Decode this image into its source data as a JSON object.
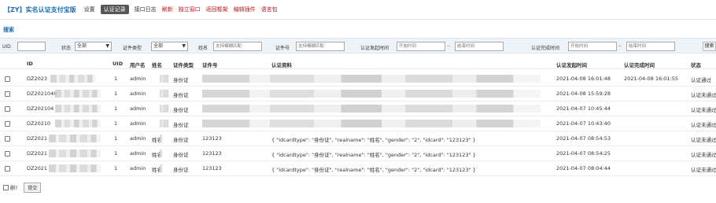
{
  "header": {
    "title": "【ZY】实名认证支付宝版",
    "nav": [
      {
        "label": "设置",
        "style": "normal"
      },
      {
        "label": "认证记录",
        "style": "active"
      },
      {
        "label": "接口日志",
        "style": "normal"
      },
      {
        "label": "刷新",
        "style": "red"
      },
      {
        "label": "独立窗口",
        "style": "red"
      },
      {
        "label": "返回框架",
        "style": "red"
      },
      {
        "label": "编辑插件",
        "style": "red"
      },
      {
        "label": "语言包",
        "style": "red"
      }
    ]
  },
  "search": {
    "title": "搜索",
    "uid_label": "UID",
    "status_label": "状态",
    "status_value": "全部",
    "cert_type_label": "证件类型",
    "cert_type_value": "全部",
    "name_label": "姓名",
    "name_placeholder": "支持模糊匹配",
    "cert_no_label": "证件号",
    "cert_no_placeholder": "支持模糊匹配",
    "start_label": "认证发起时间",
    "start_from_placeholder": "开始时间",
    "start_to_placeholder": "结束时间",
    "end_label": "认证完成时间",
    "end_from_placeholder": "开始时间",
    "end_to_placeholder": "结束时间",
    "dash": "--",
    "button": "搜索"
  },
  "table": {
    "headers": {
      "id": "ID",
      "uid": "UID",
      "username": "用户名",
      "name": "姓名",
      "cert_type": "证件类型",
      "cert_no": "证件号",
      "data": "认证资料",
      "start_time": "认证发起时间",
      "end_time": "认证完成时间",
      "status": "状态"
    },
    "rows": [
      {
        "id": "DZ2023",
        "uid": "1",
        "username": "admin",
        "name": "",
        "cert_type": "身份证",
        "cert_no": "",
        "data": "",
        "start_time": "2021-04-08 16:01:48",
        "end_time": "2021-04-08 16:01:55",
        "status": "认证通过"
      },
      {
        "id": "DZ2021040",
        "uid": "1",
        "username": "admin",
        "name": "",
        "cert_type": "身份证",
        "cert_no": "",
        "data": "",
        "start_time": "2021-04-08 15:59:28",
        "end_time": "",
        "status": "认证未通过"
      },
      {
        "id": "DZ202104",
        "uid": "1",
        "username": "admin",
        "name": "",
        "cert_type": "身份证",
        "cert_no": "",
        "data": "",
        "start_time": "2021-04-07 10:45:44",
        "end_time": "",
        "status": "认证未通过"
      },
      {
        "id": "DZ20210",
        "uid": "1",
        "username": "admin",
        "name": "",
        "cert_type": "身份证",
        "cert_no": "",
        "data": "",
        "start_time": "2021-04-07 10:43:40",
        "end_time": "",
        "status": "认证未通过"
      },
      {
        "id": "DZ2021",
        "uid": "1",
        "username": "admin",
        "name": "姓名",
        "cert_type": "身份证",
        "cert_no": "123123",
        "data": "{ \"idcardtype\": \"身份证\", \"realname\": \"姓名\", \"gender\": \"2\", \"idcard\": \"123123\" }",
        "start_time": "2021-04-07 08:54:53",
        "end_time": "",
        "status": "认证未通过"
      },
      {
        "id": "DZ2021",
        "uid": "1",
        "username": "admin",
        "name": "姓名",
        "cert_type": "身份证",
        "cert_no": "123123",
        "data": "{ \"idcardtype\": \"身份证\", \"realname\": \"姓名\", \"gender\": \"2\", \"idcard\": \"123123\" }",
        "start_time": "2021-04-07 08:54:25",
        "end_time": "",
        "status": "认证未通过"
      },
      {
        "id": "DZ2021",
        "uid": "1",
        "username": "admin",
        "name": "姓名",
        "cert_type": "身份证",
        "cert_no": "123123",
        "data": "{ \"idcardtype\": \"身份证\", \"realname\": \"姓名\", \"gender\": \"2\", \"idcard\": \"123123\" }",
        "start_time": "2021-04-07 08:04:44",
        "end_time": "",
        "status": "认证未通过"
      }
    ]
  },
  "footer": {
    "delete_label": "删?",
    "submit_label": "提交"
  },
  "colors": {
    "accent": "#1f6fb4",
    "nav_red": "#c01818",
    "filter_bg": "#eef3f8"
  }
}
